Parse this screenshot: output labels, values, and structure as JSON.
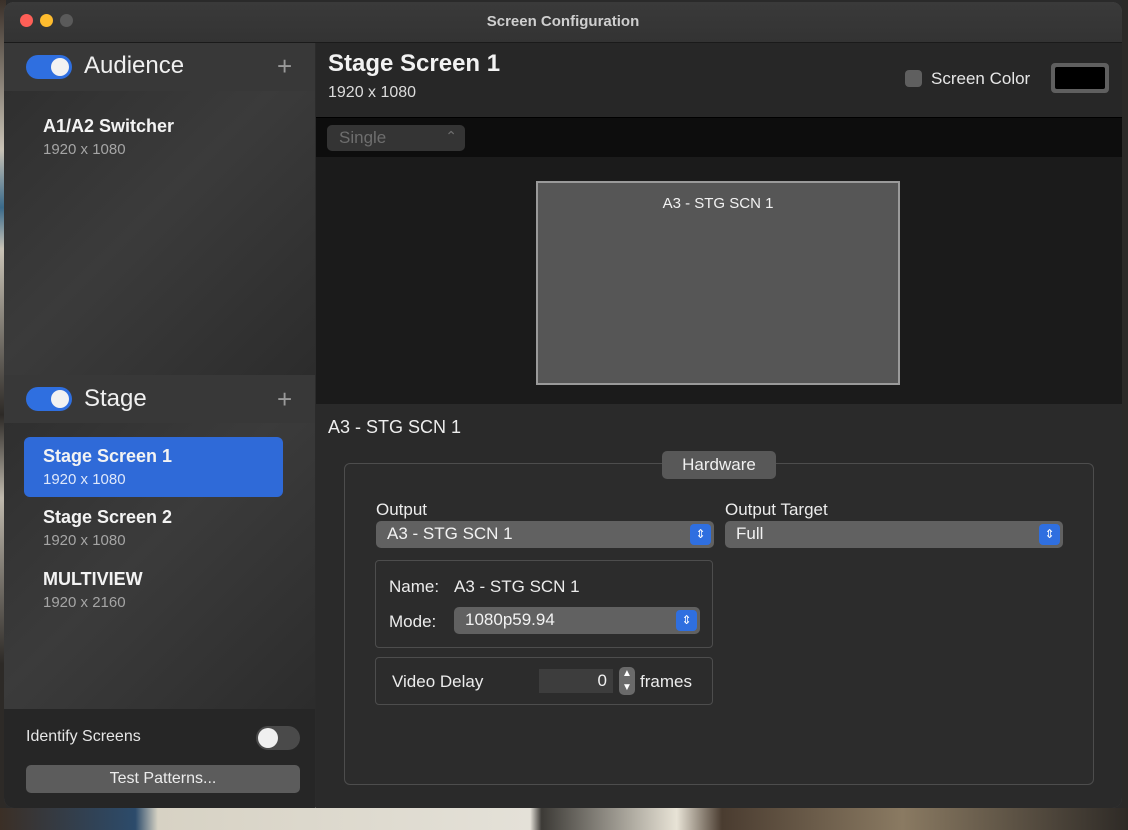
{
  "window": {
    "title": "Screen Configuration"
  },
  "sidebar": {
    "audience": {
      "label": "Audience",
      "add": "+",
      "items": [
        {
          "name": "A1/A2 Switcher",
          "res": "1920 x 1080"
        }
      ]
    },
    "stage": {
      "label": "Stage",
      "add": "+",
      "items": [
        {
          "name": "Stage Screen 1",
          "res": "1920 x 1080",
          "selected": true
        },
        {
          "name": "Stage Screen 2",
          "res": "1920 x 1080"
        },
        {
          "name": "MULTIVIEW",
          "res": "1920 x 2160"
        }
      ]
    },
    "identify_label": "Identify Screens",
    "test_patterns_label": "Test Patterns..."
  },
  "main": {
    "title": "Stage Screen 1",
    "resolution": "1920 x 1080",
    "screen_color_label": "Screen Color",
    "screen_color": "#000000",
    "layout_select": "Single",
    "preview_label": "A3 - STG SCN 1",
    "section_label": "A3 - STG SCN 1",
    "hardware_tab": "Hardware",
    "output_label": "Output",
    "output_value": "A3 - STG SCN 1",
    "output_target_label": "Output Target",
    "output_target_value": "Full",
    "name_label": "Name:",
    "name_value": "A3 - STG SCN 1",
    "mode_label": "Mode:",
    "mode_value": "1080p59.94",
    "video_delay_label": "Video Delay",
    "video_delay_value": "0",
    "frames_label": "frames"
  },
  "icons": {
    "chevron": "⌃⌄",
    "up_down": "⇕"
  },
  "colors": {
    "accent": "#2f6fe0",
    "selected_row": "#2f6ad8"
  }
}
